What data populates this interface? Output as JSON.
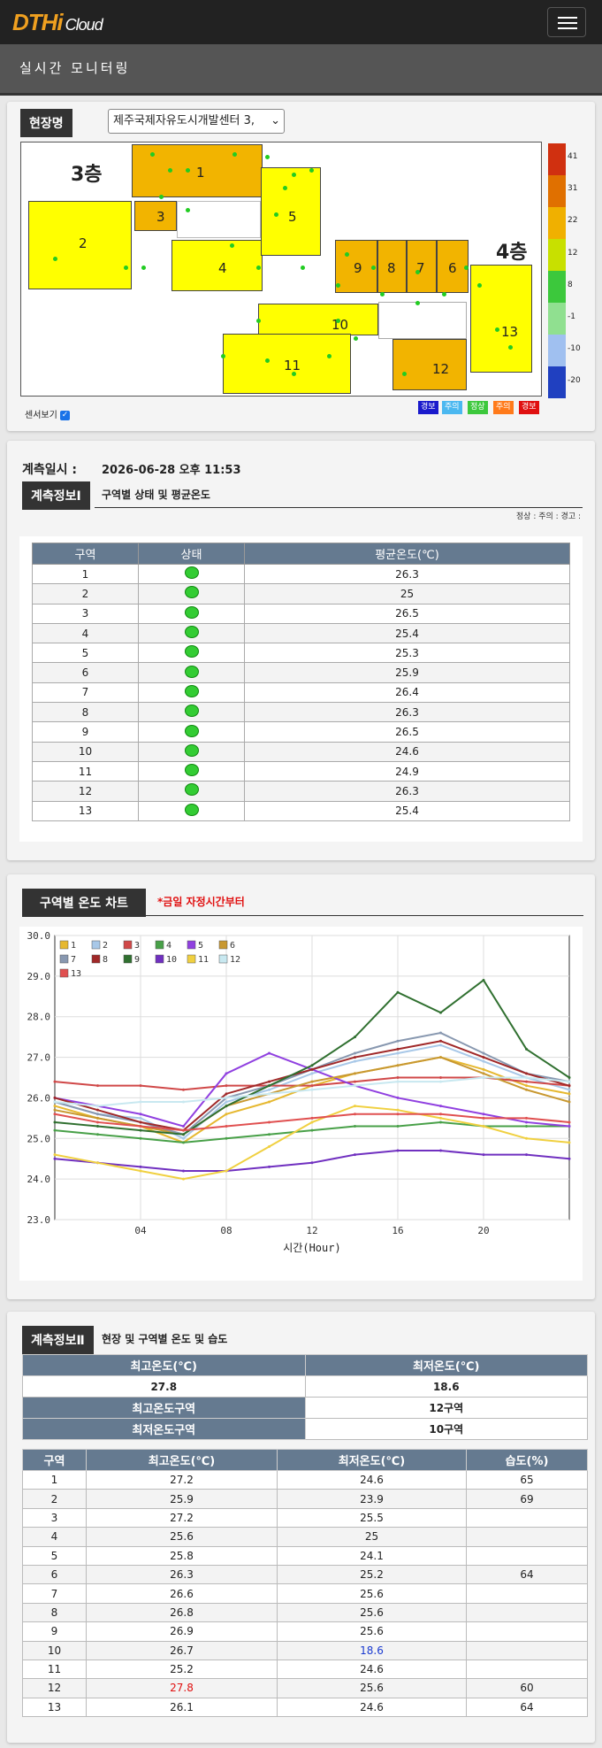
{
  "header": {
    "logo_main": "DTHi",
    "logo_sub": "Cloud",
    "page_title": "실시간 모니터링"
  },
  "site": {
    "label": "현장명",
    "selected": "제주국제자유도시개발센터 3,",
    "floor3": "3층",
    "floor4": "4층",
    "sensor_toggle": "센서보기",
    "scale_labels": [
      "41",
      "31",
      "22",
      "12",
      "8",
      "-1",
      "-10",
      "-20"
    ],
    "scale_colors": [
      "#d03010",
      "#e07000",
      "#f0b000",
      "#c8e000",
      "#3cc83c",
      "#90e090",
      "#a0c0f0",
      "#2040c0"
    ],
    "legend": [
      {
        "label": "경보",
        "color": "#1a1acc"
      },
      {
        "label": "주의",
        "color": "#4bb8f0"
      },
      {
        "label": "정상",
        "color": "#3cc83c"
      },
      {
        "label": "주의",
        "color": "#ff7a1a"
      },
      {
        "label": "경보",
        "color": "#e01010"
      }
    ],
    "zones": [
      "1",
      "2",
      "3",
      "4",
      "5",
      "6",
      "7",
      "8",
      "9",
      "10",
      "11",
      "12",
      "13"
    ]
  },
  "measure": {
    "time_label": "계측일시 :",
    "time_value": "2026-06-28 오후 11:53",
    "info1_label": "계측정보Ⅰ",
    "info1_desc": "구역별 상태 및 평균온도",
    "status_legend": "정상 :  주의 :  경고 :",
    "table_headers": [
      "구역",
      "상태",
      "평균온도(℃)"
    ],
    "rows": [
      {
        "zone": "1",
        "temp": "26.3"
      },
      {
        "zone": "2",
        "temp": "25"
      },
      {
        "zone": "3",
        "temp": "26.5"
      },
      {
        "zone": "4",
        "temp": "25.4"
      },
      {
        "zone": "5",
        "temp": "25.3"
      },
      {
        "zone": "6",
        "temp": "25.9"
      },
      {
        "zone": "7",
        "temp": "26.4"
      },
      {
        "zone": "8",
        "temp": "26.3"
      },
      {
        "zone": "9",
        "temp": "26.5"
      },
      {
        "zone": "10",
        "temp": "24.6"
      },
      {
        "zone": "11",
        "temp": "24.9"
      },
      {
        "zone": "12",
        "temp": "26.3"
      },
      {
        "zone": "13",
        "temp": "25.4"
      }
    ]
  },
  "chart_section": {
    "label": "구역별 온도 차트",
    "note": "*금일 자정시간부터"
  },
  "chart_data": {
    "type": "line",
    "xlabel": "시간(Hour)",
    "ylabel": "",
    "xlim": [
      0,
      24
    ],
    "ylim": [
      23.0,
      30.0
    ],
    "x_ticks": [
      "04",
      "08",
      "12",
      "16",
      "20"
    ],
    "y_ticks": [
      "23.0",
      "24.0",
      "25.0",
      "26.0",
      "27.0",
      "28.0",
      "29.0",
      "30.0"
    ],
    "x": [
      0,
      2,
      4,
      6,
      8,
      10,
      12,
      14,
      16,
      18,
      20,
      22,
      24
    ],
    "series": [
      {
        "name": "1",
        "color": "#e6b830",
        "values": [
          25.8,
          25.5,
          25.3,
          24.9,
          25.6,
          25.9,
          26.3,
          26.6,
          26.8,
          27.0,
          26.7,
          26.3,
          26.1
        ]
      },
      {
        "name": "2",
        "color": "#a8c8e8",
        "values": [
          25.9,
          25.6,
          25.5,
          25.0,
          25.9,
          26.2,
          26.6,
          26.9,
          27.1,
          27.3,
          26.9,
          26.5,
          26.2
        ]
      },
      {
        "name": "3",
        "color": "#d04848",
        "values": [
          26.4,
          26.3,
          26.3,
          26.2,
          26.3,
          26.3,
          26.3,
          26.4,
          26.5,
          26.5,
          26.5,
          26.4,
          26.3
        ]
      },
      {
        "name": "4",
        "color": "#48a048",
        "values": [
          25.2,
          25.1,
          25.0,
          24.9,
          25.0,
          25.1,
          25.2,
          25.3,
          25.3,
          25.4,
          25.3,
          25.3,
          25.3
        ]
      },
      {
        "name": "5",
        "color": "#9040e0",
        "values": [
          26.0,
          25.8,
          25.6,
          25.3,
          26.6,
          27.1,
          26.7,
          26.3,
          26.0,
          25.8,
          25.6,
          25.4,
          25.3
        ]
      },
      {
        "name": "6",
        "color": "#c89830",
        "values": [
          25.7,
          25.5,
          25.3,
          25.1,
          25.8,
          26.1,
          26.4,
          26.6,
          26.8,
          27.0,
          26.6,
          26.2,
          25.9
        ]
      },
      {
        "name": "7",
        "color": "#8898b0",
        "values": [
          25.9,
          25.6,
          25.4,
          25.1,
          26.0,
          26.3,
          26.7,
          27.1,
          27.4,
          27.6,
          27.1,
          26.6,
          26.4
        ]
      },
      {
        "name": "8",
        "color": "#a02828",
        "values": [
          26.0,
          25.7,
          25.4,
          25.2,
          26.1,
          26.4,
          26.7,
          27.0,
          27.2,
          27.4,
          27.0,
          26.6,
          26.3
        ]
      },
      {
        "name": "9",
        "color": "#307030",
        "values": [
          25.4,
          25.3,
          25.2,
          25.1,
          25.8,
          26.3,
          26.8,
          27.5,
          28.6,
          28.1,
          28.9,
          27.2,
          26.5
        ]
      },
      {
        "name": "10",
        "color": "#7030c0",
        "values": [
          24.5,
          24.4,
          24.3,
          24.2,
          24.2,
          24.3,
          24.4,
          24.6,
          24.7,
          24.7,
          24.6,
          24.6,
          24.5
        ]
      },
      {
        "name": "11",
        "color": "#f0d040",
        "values": [
          24.6,
          24.4,
          24.2,
          24.0,
          24.2,
          24.8,
          25.4,
          25.8,
          25.7,
          25.5,
          25.3,
          25.0,
          24.9
        ]
      },
      {
        "name": "12",
        "color": "#c8e8f0",
        "values": [
          25.9,
          25.8,
          25.9,
          25.9,
          26.0,
          26.1,
          26.2,
          26.3,
          26.4,
          26.4,
          26.5,
          26.5,
          26.4
        ]
      },
      {
        "name": "13",
        "color": "#e05050",
        "values": [
          25.6,
          25.4,
          25.3,
          25.2,
          25.3,
          25.4,
          25.5,
          25.6,
          25.6,
          25.6,
          25.5,
          25.5,
          25.4
        ]
      }
    ]
  },
  "info2": {
    "label": "계측정보Ⅱ",
    "desc": "현장 및 구역별 온도 및 습도",
    "max_label": "최고온도(℃)",
    "min_label": "최저온도(℃)",
    "max_value": "27.8",
    "min_value": "18.6",
    "max_zone_label": "최고온도구역",
    "max_zone_value": "12구역",
    "min_zone_label": "최저온도구역",
    "min_zone_value": "10구역",
    "headers": [
      "구역",
      "최고온도(℃)",
      "최저온도(℃)",
      "습도(%)"
    ],
    "rows": [
      {
        "zone": "1",
        "max": "27.2",
        "min": "24.6",
        "hum": "65"
      },
      {
        "zone": "2",
        "max": "25.9",
        "min": "23.9",
        "hum": "69"
      },
      {
        "zone": "3",
        "max": "27.2",
        "min": "25.5",
        "hum": ""
      },
      {
        "zone": "4",
        "max": "25.6",
        "min": "25",
        "hum": ""
      },
      {
        "zone": "5",
        "max": "25.8",
        "min": "24.1",
        "hum": ""
      },
      {
        "zone": "6",
        "max": "26.3",
        "min": "25.2",
        "hum": "64"
      },
      {
        "zone": "7",
        "max": "26.6",
        "min": "25.6",
        "hum": ""
      },
      {
        "zone": "8",
        "max": "26.8",
        "min": "25.6",
        "hum": ""
      },
      {
        "zone": "9",
        "max": "26.9",
        "min": "25.6",
        "hum": ""
      },
      {
        "zone": "10",
        "max": "26.7",
        "min": "18.6",
        "hum": ""
      },
      {
        "zone": "11",
        "max": "25.2",
        "min": "24.6",
        "hum": ""
      },
      {
        "zone": "12",
        "max": "27.8",
        "min": "25.6",
        "hum": "60"
      },
      {
        "zone": "13",
        "max": "26.1",
        "min": "24.6",
        "hum": "64"
      }
    ]
  }
}
